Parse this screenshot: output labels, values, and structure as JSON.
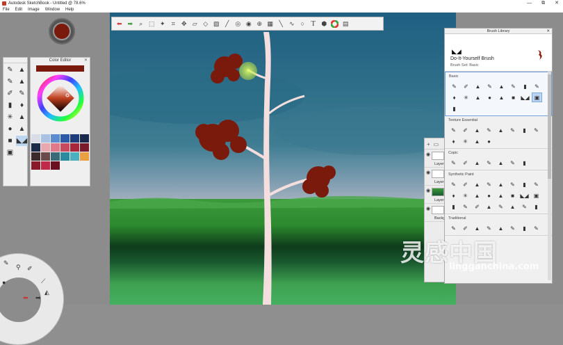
{
  "window": {
    "title": "Autodesk SketchBook - Untitled @ 78.6%",
    "controls": [
      "—",
      "⧉",
      "✕"
    ]
  },
  "menu": [
    "File",
    "Edit",
    "Image",
    "Window",
    "Help"
  ],
  "toolbar": {
    "icons": [
      "undo-icon",
      "redo-icon",
      "zoom-icon",
      "select-icon",
      "magic-wand-icon",
      "crop-icon",
      "transform-icon",
      "distort-icon",
      "perspective-icon",
      "fill-icon",
      "ruler-icon",
      "ellipse-guide-icon",
      "steady-stroke-icon",
      "symmetry-icon",
      "perspective-grid-icon",
      "line-icon",
      "curve-icon",
      "shape-icon",
      "text-icon",
      "copic-library-icon",
      "color-wheel-icon",
      "brush-palette-icon"
    ]
  },
  "colors": {
    "current_color": "#7a1a0c",
    "accent": "#6fa0dc"
  },
  "color_editor": {
    "title": "Color Editor",
    "swatches": [
      "#d8dde6",
      "#a9c1e2",
      "#5c8cd0",
      "#2b5aa8",
      "#1c3c7a",
      "#1a2a4f",
      "#1a2b4a",
      "#e8a8b0",
      "#e07a8a",
      "#c84a5e",
      "#a8263a",
      "#7a1a2a",
      "#3c2a2a",
      "#6a4a4a",
      "#3a6a78",
      "#2a8aa0",
      "#4ab0c0",
      "#e8a040",
      "#8a1a2a",
      "#c02a48",
      "#6a1020"
    ]
  },
  "brush_library": {
    "title": "Brush Library",
    "selected_brush": "Do-It-Yourself Brush",
    "brush_set": "Brush Set: Basic",
    "sections": [
      {
        "name": "Basic",
        "count": 17
      },
      {
        "name": "Texture Essential",
        "count": 12
      },
      {
        "name": "Copic",
        "count": 7
      },
      {
        "name": "Synthetic Paint",
        "count": 24
      },
      {
        "name": "Traditional",
        "count": 8
      }
    ]
  },
  "layers": {
    "rows": [
      "Layer1",
      "Layer2",
      "Layer3",
      "Background"
    ]
  },
  "watermark": {
    "text": "灵感中国",
    "url": "lingganchina.com"
  }
}
